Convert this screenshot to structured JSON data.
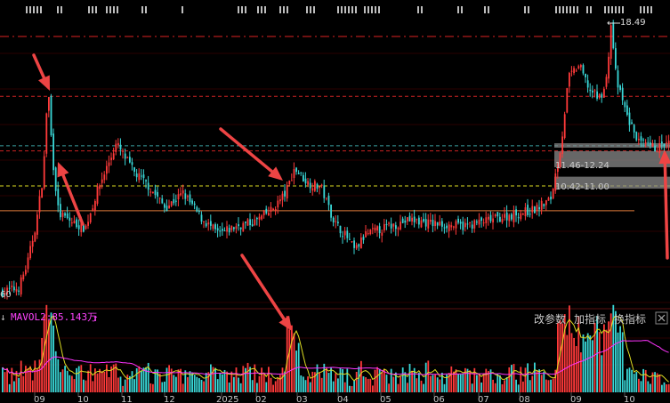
{
  "chart_data": {
    "type": "candlestick",
    "y_axis": {
      "min": 4.9,
      "max": 18.49,
      "scale": "linear",
      "tick_labels": [
        "60"
      ]
    },
    "price_high_marker": "18.49",
    "zones": [
      {
        "label": "11.46-12.24",
        "low": 11.46,
        "high": 12.24
      },
      {
        "label": "10.42-11.00",
        "low": 10.42,
        "high": 11.0
      }
    ],
    "reference_lines": [
      {
        "price": 17.8,
        "style": "dash-dot",
        "color": "#dd2222"
      },
      {
        "price": 14.9,
        "style": "dashed",
        "color": "#cc2222"
      },
      {
        "price": 12.25,
        "style": "dashed",
        "color": "#cc2222"
      },
      {
        "price": 12.5,
        "style": "dashed",
        "color": "#3aa0a0"
      },
      {
        "price": 10.55,
        "style": "dashed",
        "color": "#dddd22"
      },
      {
        "price": 9.35,
        "style": "solid",
        "color": "#e07a3a"
      }
    ],
    "x_axis": {
      "tick_labels": [
        "09",
        "10",
        "11",
        "12",
        "2025",
        "02",
        "03",
        "04",
        "05",
        "06",
        "07",
        "08",
        "09",
        "10"
      ]
    },
    "volume": {
      "indicator_label": "MAVOL2:85.143万",
      "trend_arrow": "↑",
      "ma_colors": [
        "#dddd22",
        "#ff33ff"
      ]
    },
    "grid": true,
    "colors": {
      "up": "#ff3a3a",
      "down": "#39d6d6",
      "background": "#000000",
      "annotation_arrow": "#ee4444",
      "text": "#c8c8c8",
      "indicator": "#ff44ff"
    }
  },
  "toolbar": {
    "change_params": "改参数",
    "add_indicator": "加指标",
    "switch_indicator": "换指标",
    "close_icon": "close-icon"
  }
}
